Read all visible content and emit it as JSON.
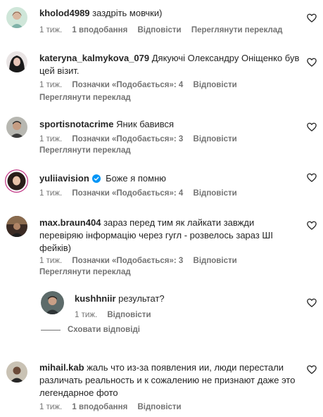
{
  "comments": [
    {
      "username": "kholod4989",
      "text": "заздріть мовчки)",
      "time": "1 тиж.",
      "likes": "1 вподобання",
      "reply": "Відповісти",
      "translate": "Переглянути переклад"
    },
    {
      "username": "kateryna_kalmykova_079",
      "text": "Дякуючі Олександру Оніщенко був цей візит.",
      "text_line1": "Дякуючі Олександру Оніщенко був",
      "text_line2": "цей візит.",
      "time": "1 тиж.",
      "likes": "Позначки «Подобається»: 4",
      "reply": "Відповісти",
      "translate": "Переглянути переклад"
    },
    {
      "username": "sportisnotacrime",
      "text": "Яник бавився",
      "time": "1 тиж.",
      "likes": "Позначки «Подобається»: 3",
      "reply": "Відповісти",
      "translate": "Переглянути переклад"
    },
    {
      "username": "yuliiavision",
      "text": "Боже я помню",
      "time": "1 тиж.",
      "likes": "Позначки «Подобається»: 4",
      "reply": "Відповісти"
    },
    {
      "username": "max.braun404",
      "text_line1": "зараз перед тим як лайкати завжди",
      "text_line2": "перевіряю інформацію через гугл - розвелось зараз ШІ",
      "text_line3": "фейків)",
      "time": "1 тиж.",
      "likes": "Позначки «Подобається»: 3",
      "reply": "Відповісти",
      "translate": "Переглянути переклад"
    },
    {
      "username": "kushhniir",
      "text": "результат?",
      "time": "1 тиж.",
      "reply": "Відповісти",
      "hide_replies": "Сховати відповіді"
    },
    {
      "username": "mihail.kab",
      "text_line1": "жаль что из-за появления ии, люди перестали",
      "text_line2": "различать реальность и к сожалению не признают даже это",
      "text_line3": "легендарное фото",
      "time": "1 тиж.",
      "likes": "1 вподобання",
      "reply": "Відповісти"
    }
  ],
  "icons": {
    "like": "heart-icon",
    "verified": "verified-badge-icon"
  },
  "colors": {
    "text": "#262626",
    "secondary": "#737373",
    "verified": "#0095f6"
  }
}
